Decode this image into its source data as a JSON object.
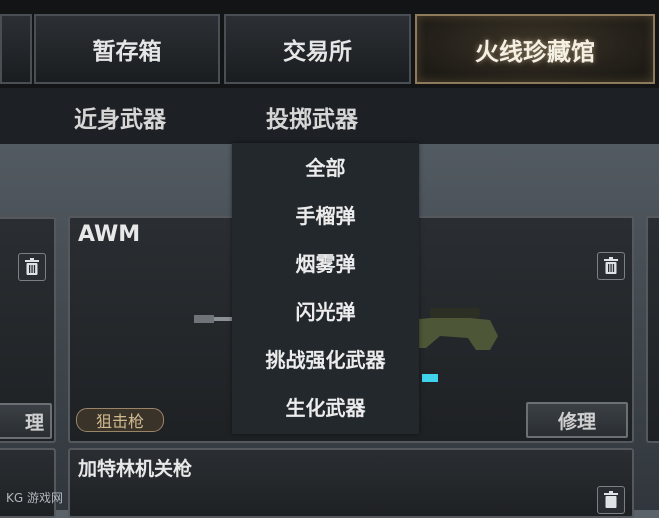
{
  "tabs": [
    {
      "label": "暂存箱"
    },
    {
      "label": "交易所"
    },
    {
      "label": "火线珍藏馆"
    }
  ],
  "subtabs": [
    {
      "label": "近身武器"
    },
    {
      "label": "投掷武器"
    }
  ],
  "dropdown": {
    "items": [
      "全部",
      "手榴弹",
      "烟雾弹",
      "闪光弹",
      "挑战强化武器",
      "生化武器"
    ]
  },
  "cards": {
    "left_partial": {
      "repair_label": "理"
    },
    "awm": {
      "title": "AWM",
      "badge": "狙击枪",
      "repair_label": "修理"
    },
    "gatling": {
      "title": "加特林机关枪"
    }
  },
  "watermark": "KG 游戏网",
  "colors": {
    "accent_bar": "#3fd4ec",
    "badge_border": "#9a8466"
  }
}
